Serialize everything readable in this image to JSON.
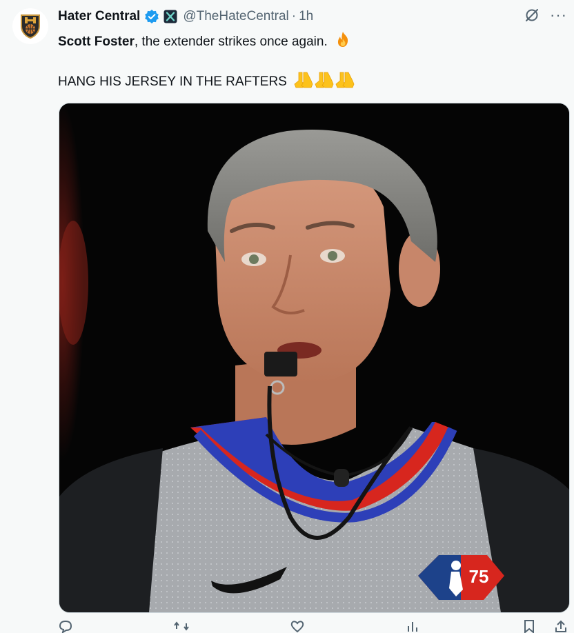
{
  "account": {
    "display_name": "Hater Central",
    "handle": "@TheHateCentral",
    "separator": "·",
    "time": "1h",
    "verified": true,
    "avatar_icon": "hater-central-logo-icon",
    "affiliate_icon": "x-affiliate-badge-icon"
  },
  "tweet": {
    "mention": "Scott Foster",
    "line1_rest": ", the extender strikes once again.",
    "line1_emoji": "fire-emoji",
    "line2_text": "HANG HIS JERSEY IN THE RAFTERS",
    "line2_emoji": "folded-hands-emoji",
    "line2_emoji_count": 3
  },
  "media": {
    "type": "photo",
    "logo_text": "75"
  },
  "top_actions": {
    "more_label": "···",
    "grok_icon": "grok-icon"
  },
  "colors": {
    "verified": "#1d9bf0",
    "text": "#0f1419",
    "secondary": "#536471",
    "jersey_blue": "#2d3fb8",
    "jersey_red": "#d7261e"
  }
}
